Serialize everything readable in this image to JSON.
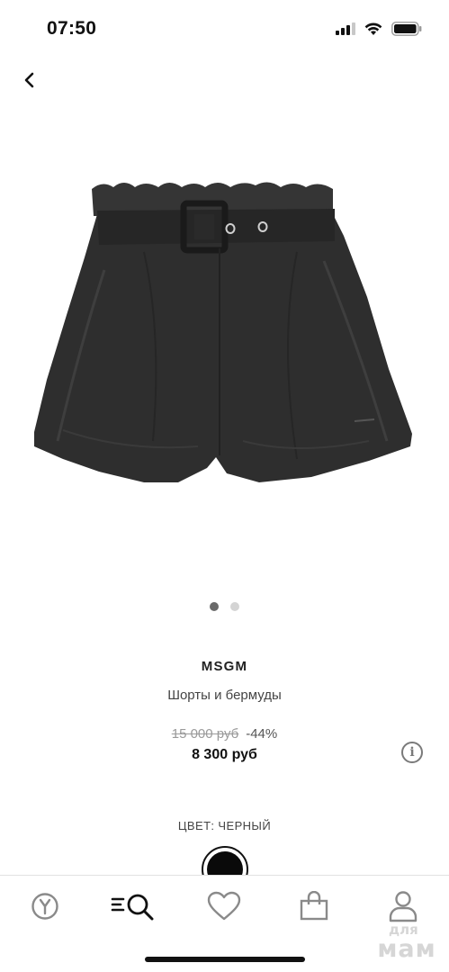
{
  "status_bar": {
    "time": "07:50",
    "icons": [
      "signal-icon",
      "wifi-icon",
      "battery-icon"
    ]
  },
  "nav": {
    "back_icon": "chevron-left-icon"
  },
  "product": {
    "image": "black-shorts-with-belt",
    "image_count": 2,
    "active_image": 1,
    "brand": "MSGM",
    "name": "Шорты и бермуды",
    "old_price": "15 000 руб",
    "discount": "-44%",
    "price": "8 300 руб",
    "color_label": "ЦВЕТ: ЧЕРНЫЙ",
    "color_swatch": "#0a0a0a"
  },
  "tab_bar": {
    "tabs": [
      {
        "name": "home",
        "icon": "brand-logo-icon"
      },
      {
        "name": "catalog-search",
        "icon": "menu-search-icon"
      },
      {
        "name": "favorites",
        "icon": "heart-icon"
      },
      {
        "name": "cart",
        "icon": "shopping-bag-icon"
      },
      {
        "name": "profile",
        "icon": "user-icon"
      }
    ]
  },
  "watermark": {
    "top": "для",
    "bottom": "мам"
  }
}
